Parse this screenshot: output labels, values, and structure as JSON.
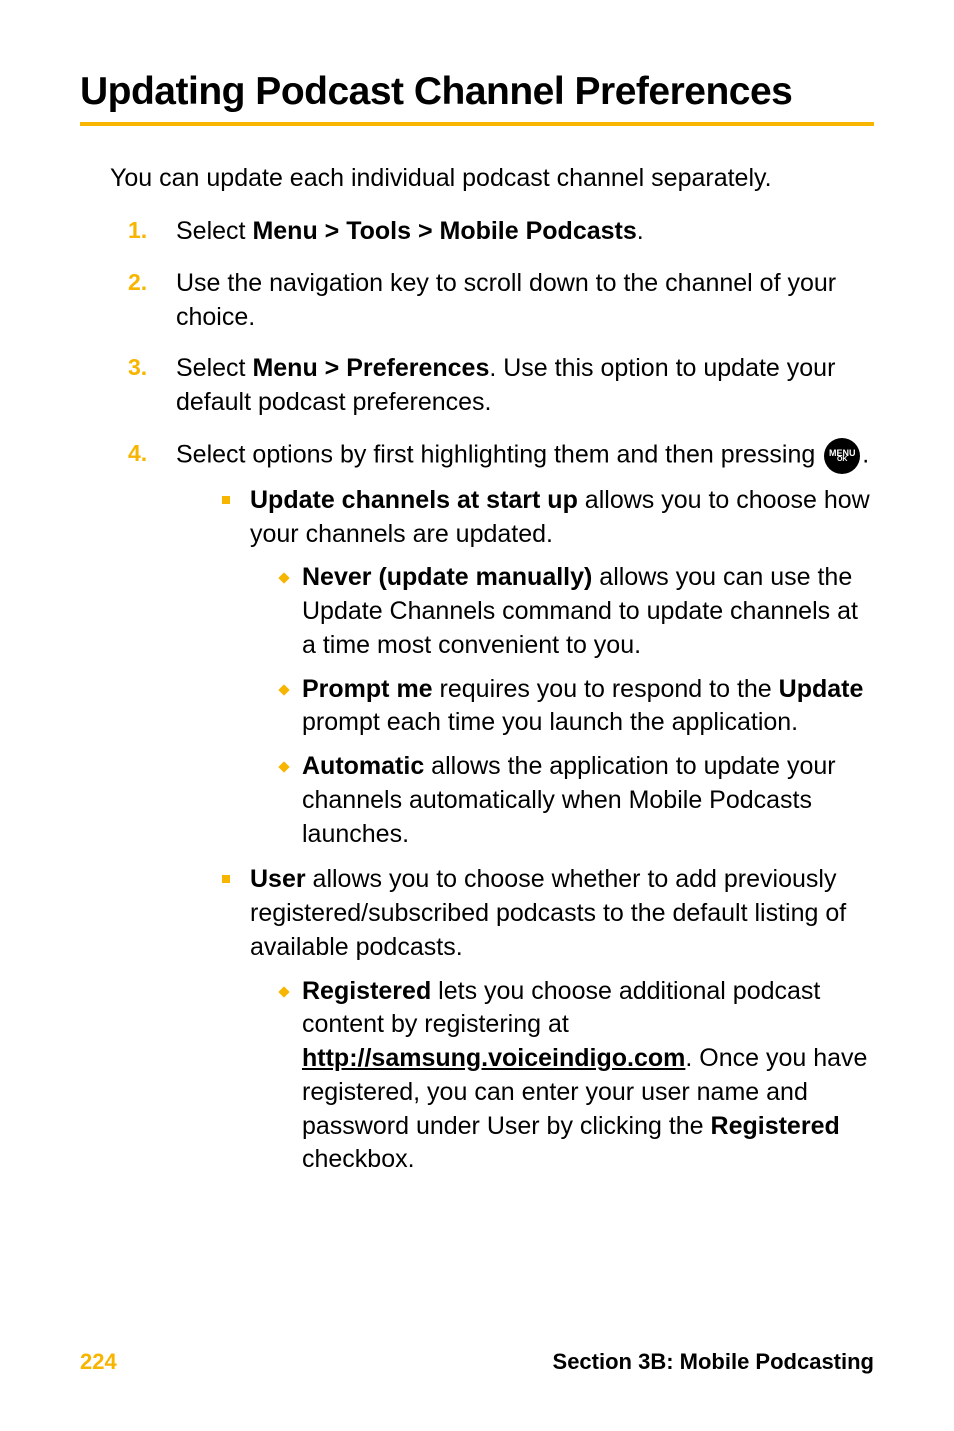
{
  "heading": "Updating Podcast Channel Preferences",
  "intro": "You can update each individual podcast channel separately.",
  "steps": [
    {
      "num": "1.",
      "prefix": "Select ",
      "bold": "Menu > Tools > Mobile Podcasts",
      "suffix": "."
    },
    {
      "num": "2.",
      "text": "Use the navigation key to scroll down to the channel of your choice."
    },
    {
      "num": "3.",
      "prefix": "Select ",
      "bold": "Menu > Preferences",
      "suffix": ". Use this option to update your default podcast preferences."
    },
    {
      "num": "4.",
      "text_before_icon": "Select options by first highlighting them and then pressing ",
      "text_after_icon": "."
    }
  ],
  "icon": {
    "top": "MENU",
    "bot": "OK"
  },
  "sub1": {
    "bold": "Update channels at start up",
    "rest": " allows you to choose how your channels are updated."
  },
  "sub1_items": [
    {
      "bold": "Never (update manually)",
      "rest": " allows you can use the Update Channels command to update channels at a time most convenient to you."
    },
    {
      "bold": "Prompt me",
      "mid": " requires you to respond to the ",
      "bold2": "Update",
      "rest": " prompt each time you launch the application."
    },
    {
      "bold": "Automatic",
      "rest": " allows the application to update your channels automatically when Mobile Podcasts launches."
    }
  ],
  "sub2": {
    "bold": "User",
    "rest": " allows you to choose whether to add previously registered/subscribed podcasts to the default listing of available podcasts."
  },
  "sub2_items": [
    {
      "bold": "Registered",
      "mid1": " lets you choose additional podcast content by registering at ",
      "link": "http://samsung.voiceindigo.com",
      "mid2": ". Once you have registered, you can enter your user name and password under User by clicking the ",
      "bold2": "Registered",
      "rest": " checkbox."
    }
  ],
  "footer": {
    "page": "224",
    "section": "Section 3B: Mobile Podcasting"
  }
}
